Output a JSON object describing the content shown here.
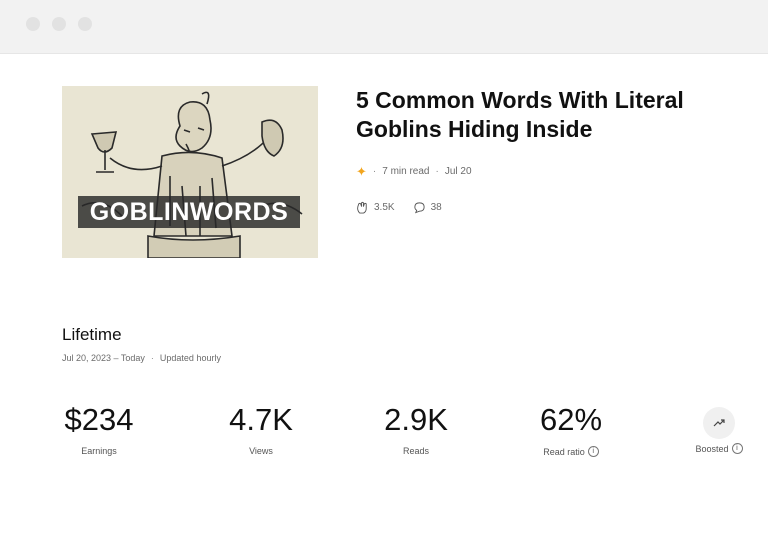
{
  "browser": {
    "dots": 3
  },
  "article": {
    "image_label": "GOBLINWORDS",
    "title": "5 Common Words With Literal Goblins Hiding Inside",
    "read_time": "7 min read",
    "date": "Jul 20",
    "claps": "3.5K",
    "responses": "38"
  },
  "lifetime": {
    "heading": "Lifetime",
    "range": "Jul 20, 2023 – Today",
    "updated": "Updated hourly"
  },
  "metrics": {
    "earnings": {
      "value": "$234",
      "label": "Earnings"
    },
    "views": {
      "value": "4.7K",
      "label": "Views"
    },
    "reads": {
      "value": "2.9K",
      "label": "Reads"
    },
    "read_ratio": {
      "value": "62%",
      "label": "Read ratio"
    },
    "boosted": {
      "label": "Boosted"
    }
  },
  "colors": {
    "star": "#f2a51e",
    "browser_bar": "#f2f2f2"
  }
}
